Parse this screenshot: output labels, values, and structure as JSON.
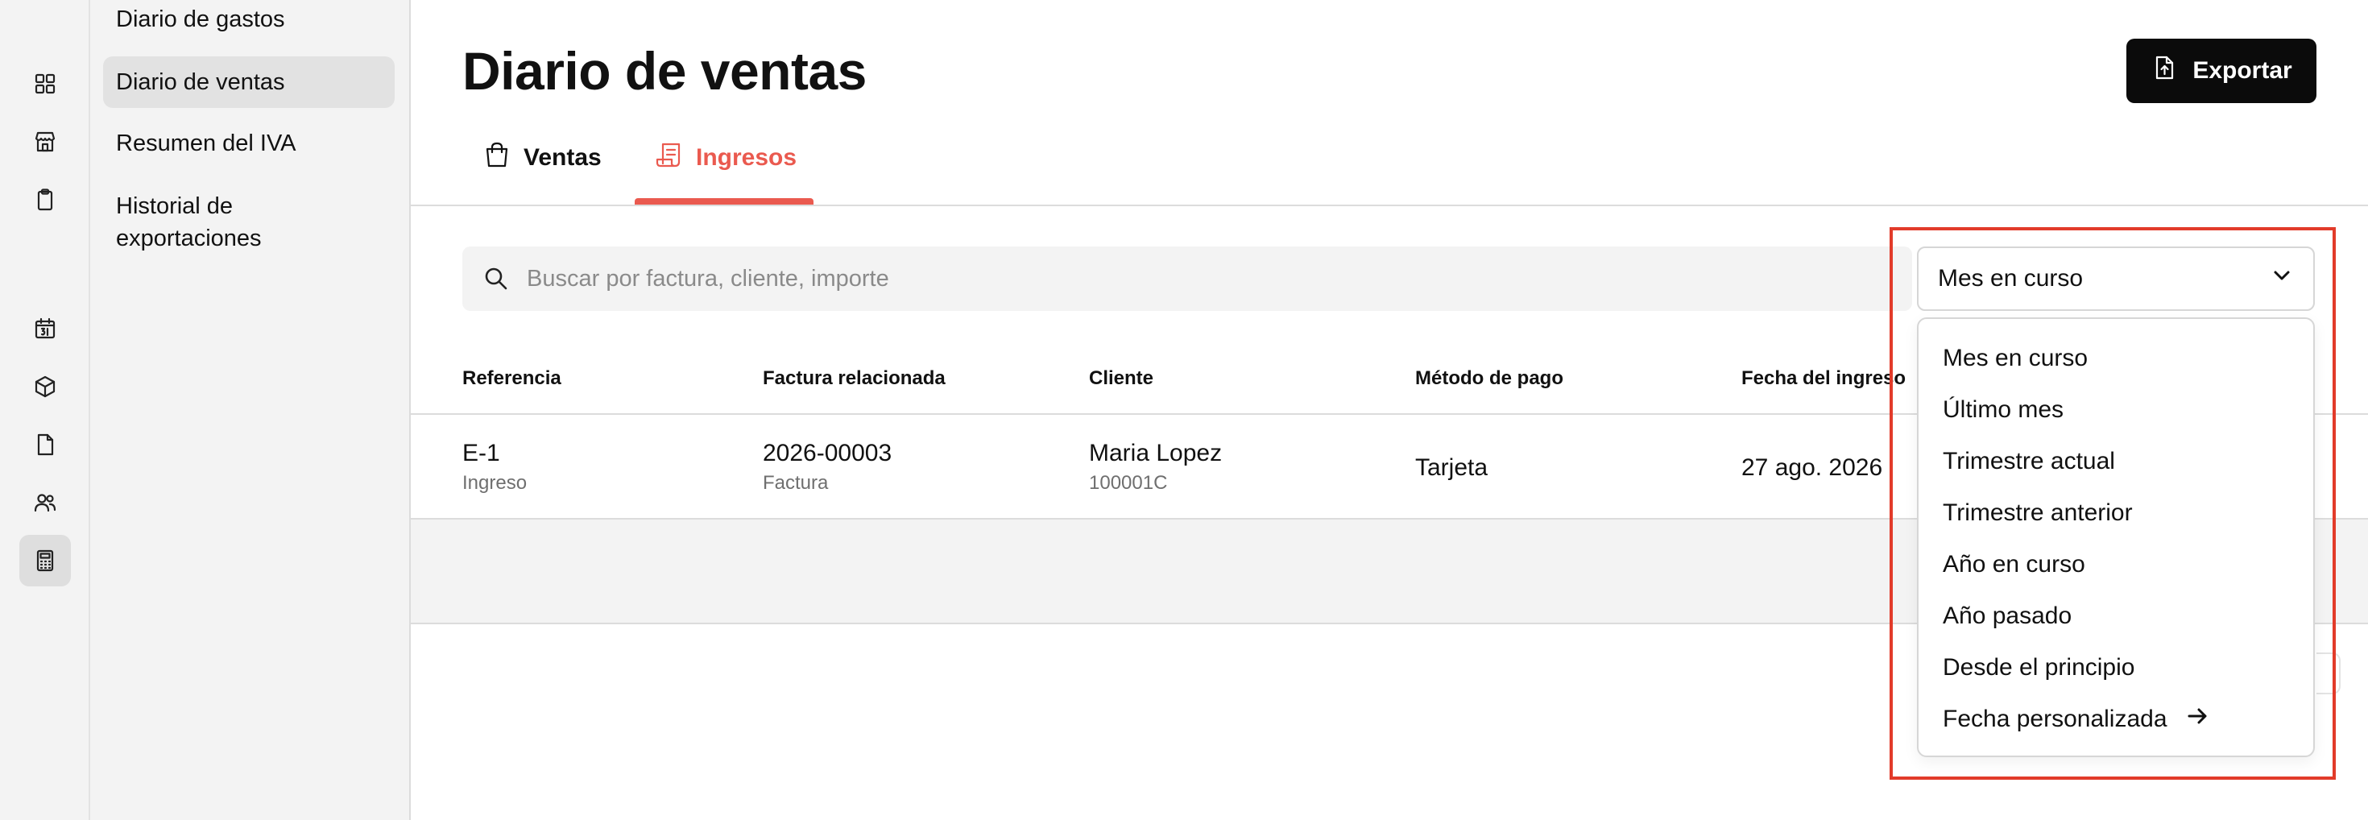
{
  "rail": {
    "icons": [
      "grid-icon",
      "store-icon",
      "clipboard-icon",
      "calendar-icon",
      "box-icon",
      "file-icon",
      "users-icon",
      "calculator-icon"
    ]
  },
  "subnav": {
    "items": [
      {
        "label": "Diario de gastos"
      },
      {
        "label": "Diario de ventas"
      },
      {
        "label": "Resumen del IVA"
      },
      {
        "label": "Historial de exportaciones"
      }
    ]
  },
  "header": {
    "title": "Diario de ventas",
    "export_label": "Exportar"
  },
  "tabs": [
    {
      "label": "Ventas",
      "icon": "shopping-bag-icon"
    },
    {
      "label": "Ingresos",
      "icon": "receipt-icon",
      "active": true
    }
  ],
  "search": {
    "placeholder": "Buscar por factura, cliente, importe",
    "value": ""
  },
  "table": {
    "headers": [
      "Referencia",
      "Factura relacionada",
      "Cliente",
      "Método de pago",
      "Fecha del ingreso"
    ],
    "rows": [
      {
        "referencia": "E-1",
        "referencia_sub": "Ingreso",
        "factura": "2026-00003",
        "factura_sub": "Factura",
        "cliente": "Maria Lopez",
        "cliente_sub": "100001C",
        "metodo": "Tarjeta",
        "fecha": "27 ago. 2026"
      }
    ]
  },
  "period": {
    "selected": "Mes en curso",
    "options": [
      "Mes en curso",
      "Último mes",
      "Trimestre actual",
      "Trimestre anterior",
      "Año en curso",
      "Año pasado",
      "Desde el principio",
      "Fecha personalizada"
    ]
  },
  "colors": {
    "accent": "#ea5a4f",
    "highlight": "#e23b2a",
    "button_bg": "#0b0b0b",
    "sidebar_bg": "#f3f3f3"
  }
}
